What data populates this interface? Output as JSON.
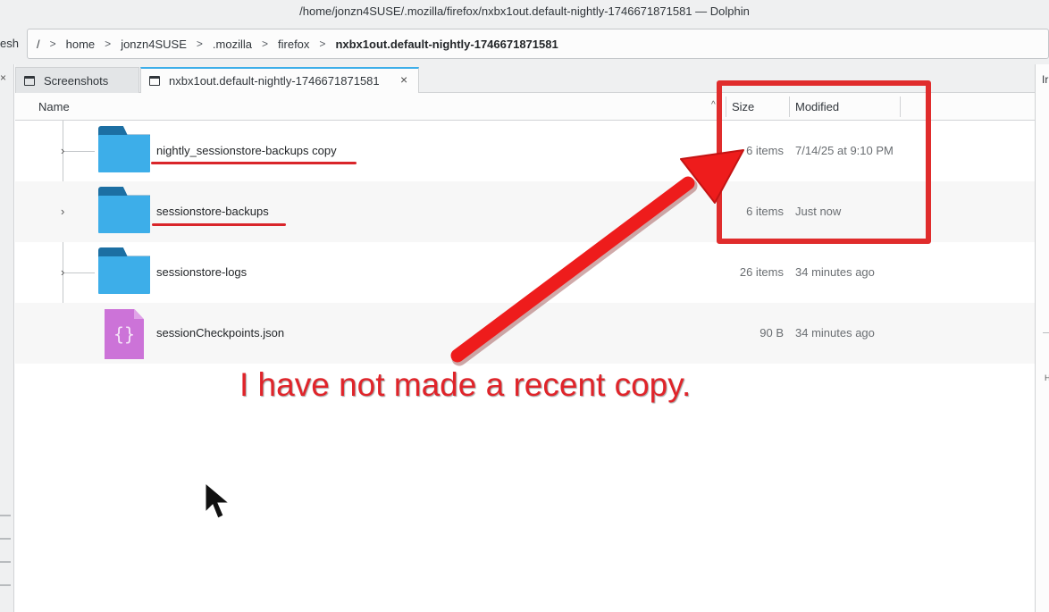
{
  "window": {
    "title": "/home/jonzn4SUSE/.mozilla/firefox/nxbx1out.default-nightly-1746671871581 — Dolphin"
  },
  "toolbar": {
    "left_fragment": "esh"
  },
  "breadcrumb": [
    {
      "label": "/"
    },
    {
      "label": "home"
    },
    {
      "label": "jonzn4SUSE"
    },
    {
      "label": ".mozilla"
    },
    {
      "label": "firefox"
    },
    {
      "label": "nxbx1out.default-nightly-1746671871581"
    }
  ],
  "tabs": [
    {
      "label": "Screenshots"
    },
    {
      "label": "nxbx1out.default-nightly-1746671871581"
    }
  ],
  "right_panel": {
    "label_fragment": "Ir",
    "small_fragment": "H"
  },
  "columns": {
    "name": "Name",
    "size": "Size",
    "modified": "Modified"
  },
  "files": [
    {
      "name": "nightly_sessionstore-backups copy",
      "size": "6 items",
      "modified": "7/14/25 at 9:10 PM",
      "type": "folder"
    },
    {
      "name": "sessionstore-backups",
      "size": "6 items",
      "modified": "Just now",
      "type": "folder"
    },
    {
      "name": "sessionstore-logs",
      "size": "26 items",
      "modified": "34 minutes ago",
      "type": "folder"
    },
    {
      "name": "sessionCheckpoints.json",
      "size": "90 B",
      "modified": "34 minutes ago",
      "type": "json"
    }
  ],
  "annotation": {
    "text": "I have not made a recent copy.",
    "color": "#e0242a"
  },
  "colors": {
    "accent": "#3daee9",
    "folder_back": "#1c6fa3",
    "json_file": "#cc73d8"
  },
  "icons": {
    "close": "×",
    "chevron_right": "›",
    "json_glyph": "{}"
  }
}
